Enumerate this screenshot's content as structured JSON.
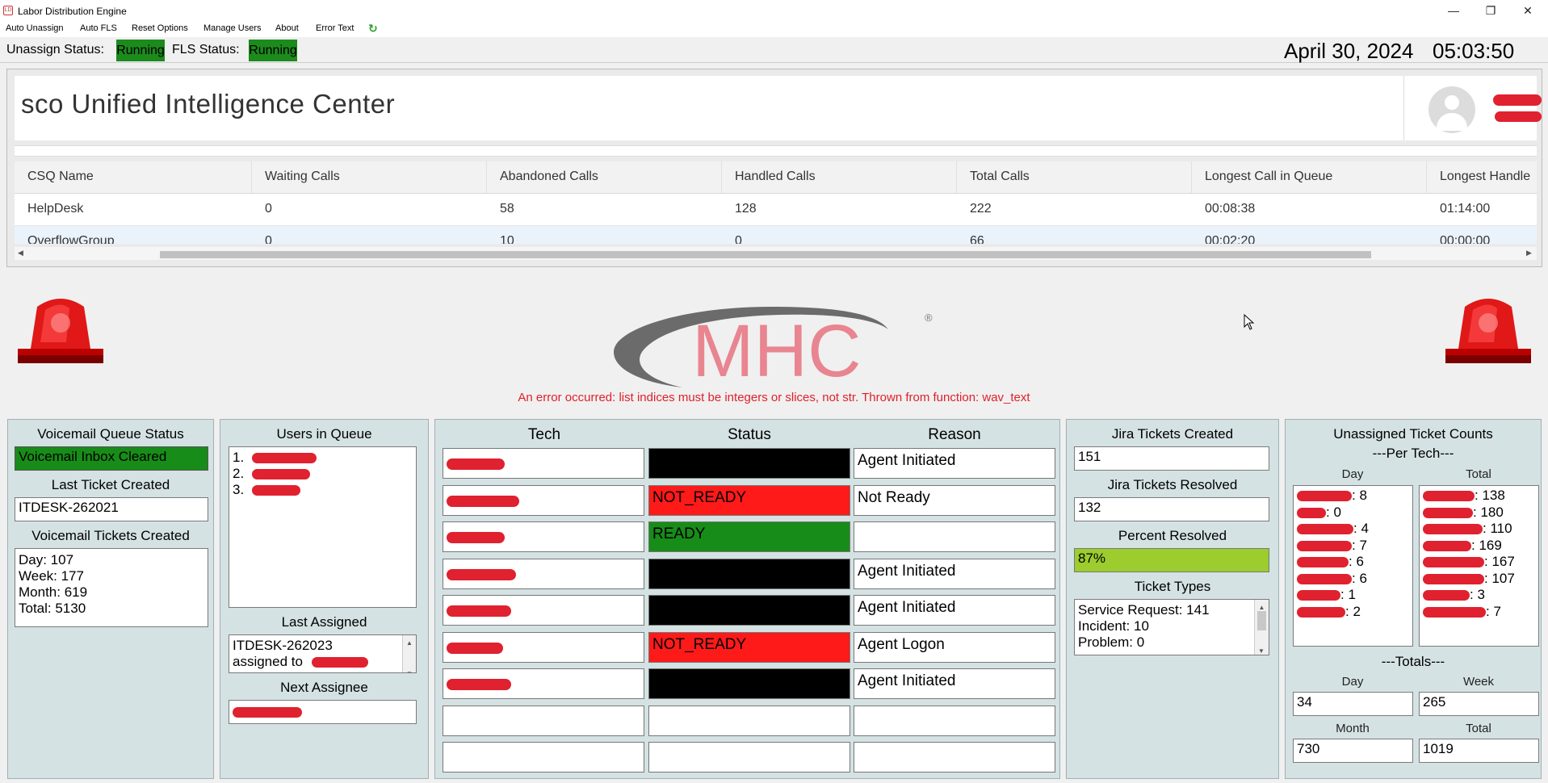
{
  "window": {
    "title": "Labor Distribution Engine",
    "minimize": "—",
    "maximize": "❐",
    "close": "✕"
  },
  "menu": {
    "items": [
      "Auto Unassign",
      "Auto FLS",
      "Reset Options",
      "Manage Users",
      "About",
      "Error Text"
    ],
    "refresh_icon": "↻"
  },
  "status": {
    "unassign_label": "Unassign Status:",
    "unassign_value": "Running",
    "fls_label": "FLS Status:",
    "fls_value": "Running",
    "date": "April 30, 2024",
    "time": "05:03:50"
  },
  "dashboard": {
    "title": "sco Unified Intelligence Center",
    "columns": [
      "CSQ Name",
      "Waiting Calls",
      "Abandoned Calls",
      "Handled Calls",
      "Total Calls",
      "Longest Call in Queue",
      "Longest Handle"
    ],
    "rows": [
      [
        "HelpDesk",
        "0",
        "58",
        "128",
        "222",
        "00:08:38",
        "01:14:00"
      ],
      [
        "OverflowGroup",
        "0",
        "10",
        "0",
        "66",
        "00:02:20",
        "00:00:00"
      ]
    ]
  },
  "logo": {
    "text": "MHC",
    "registered": "®"
  },
  "error_text": "An error occurred: list indices must be integers or slices, not str. Thrown from function: wav_text",
  "voicemail": {
    "title": "Voicemail Queue Status",
    "status": "Voicemail Inbox Cleared",
    "last_ticket_label": "Last Ticket Created",
    "last_ticket": "ITDESK-262021",
    "created_label": "Voicemail Tickets Created",
    "day": "Day: 107",
    "week": "Week: 177",
    "month": "Month: 619",
    "total": "Total: 5130"
  },
  "queue": {
    "title": "Users in Queue",
    "items": [
      "1.",
      "2.",
      "3."
    ],
    "last_assigned_label": "Last Assigned",
    "last_assigned_line1": "ITDESK-262023",
    "last_assigned_line2": "assigned to",
    "next_assignee_label": "Next Assignee"
  },
  "techs": {
    "col_tech": "Tech",
    "col_status": "Status",
    "col_reason": "Reason",
    "rows": [
      {
        "status": "",
        "reason": "Agent Initiated",
        "color": "#000000"
      },
      {
        "status": "NOT_READY",
        "reason": "Not Ready",
        "color": "#ff1a1a"
      },
      {
        "status": "READY",
        "reason": "",
        "color": "#188c18"
      },
      {
        "status": "",
        "reason": "Agent Initiated",
        "color": "#000000"
      },
      {
        "status": "",
        "reason": "Agent Initiated",
        "color": "#000000"
      },
      {
        "status": "NOT_READY",
        "reason": "Agent Logon",
        "color": "#ff1a1a"
      },
      {
        "status": "",
        "reason": "Agent Initiated",
        "color": "#000000"
      },
      {
        "status": "",
        "reason": "",
        "color": "#ffffff"
      },
      {
        "status": "",
        "reason": "",
        "color": "#ffffff"
      }
    ]
  },
  "jira": {
    "created_label": "Jira Tickets Created",
    "created": "151",
    "resolved_label": "Jira Tickets Resolved",
    "resolved": "132",
    "percent_label": "Percent Resolved",
    "percent": "87%",
    "types_label": "Ticket Types",
    "type1": "Service Request: 141",
    "type2": "Incident: 10",
    "type3": "Problem: 0"
  },
  "unassigned": {
    "title": "Unassigned Ticket Counts",
    "per_tech": "---Per Tech---",
    "day_label": "Day",
    "total_label": "Total",
    "day_values": [
      ": 8",
      ": 0",
      ": 4",
      ": 7",
      ": 6",
      ": 6",
      ": 1",
      ": 2"
    ],
    "total_values": [
      ": 138",
      ": 180",
      ": 110",
      ": 169",
      ": 167",
      ": 107",
      ": 3",
      ": 7"
    ],
    "totals_label": "---Totals---",
    "t_day_label": "Day",
    "t_week_label": "Week",
    "t_month_label": "Month",
    "t_total_label": "Total",
    "t_day": "34",
    "t_week": "265",
    "t_month": "730",
    "t_total": "1019"
  }
}
